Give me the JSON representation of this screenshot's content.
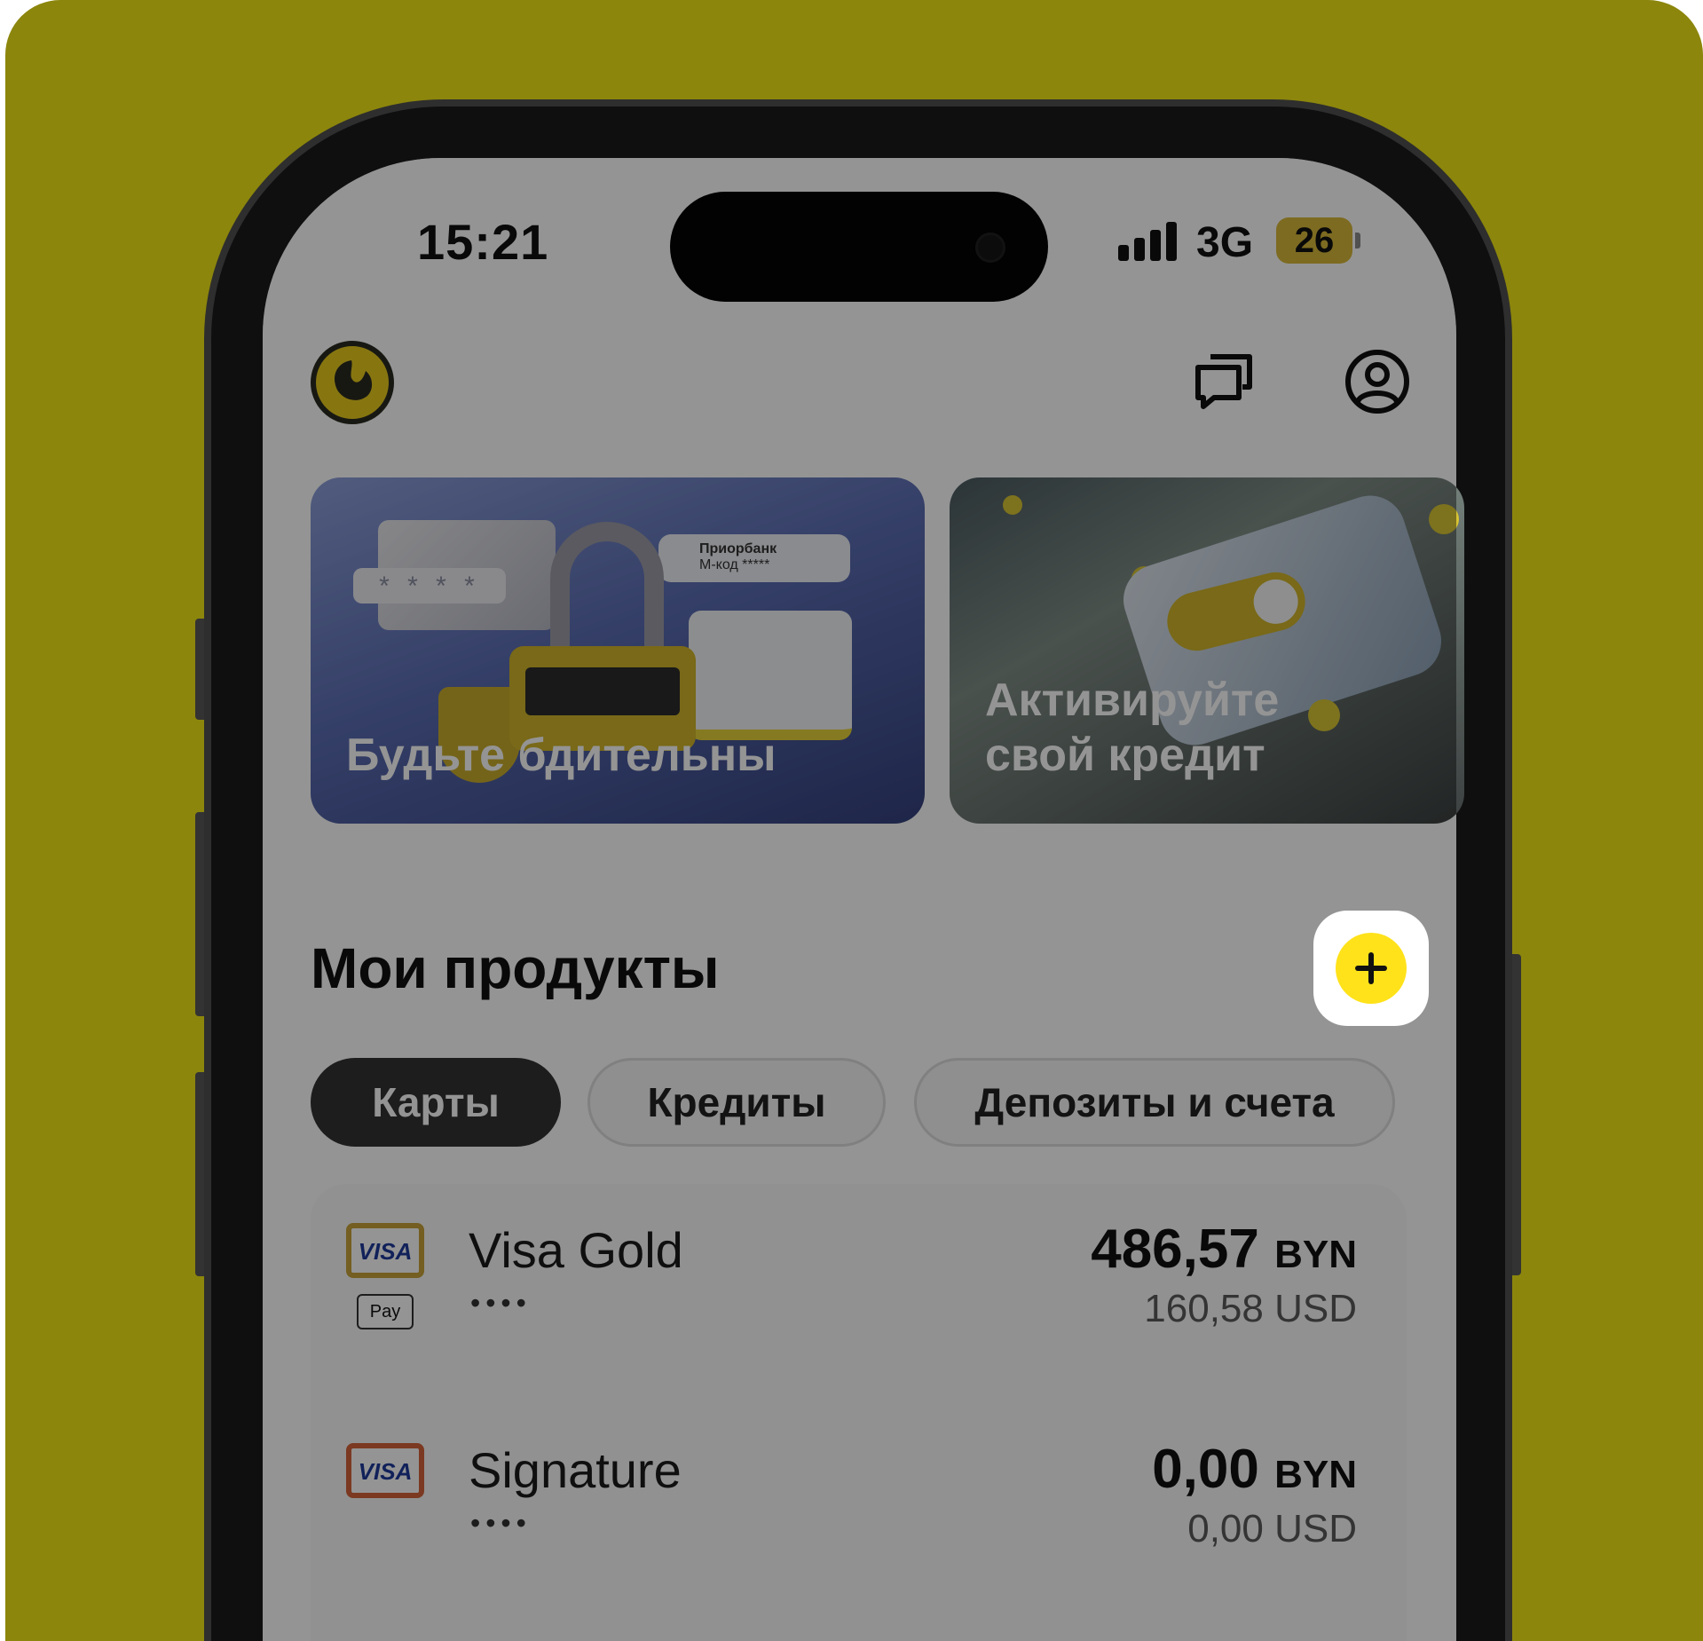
{
  "status_bar": {
    "time": "15:21",
    "network": "3G",
    "battery": "26"
  },
  "header": {
    "logo_icon": "bank-logo-icon",
    "chat_icon": "chat-icon",
    "profile_icon": "profile-icon"
  },
  "banners": [
    {
      "title_line1": "Будьте бдительны",
      "title_line2": "",
      "pin_text": "* * * *",
      "mcode_line1": "Приорбанк",
      "mcode_line2": "М-код *****"
    },
    {
      "title_line1": "Активируйте",
      "title_line2": "свой кредит"
    }
  ],
  "products": {
    "title": "Мои продукты",
    "add_icon": "plus-icon",
    "tabs": [
      "Карты",
      "Кредиты",
      "Депозиты и счета"
    ],
    "cards": [
      {
        "brand": "VISA",
        "wallet": "Pay",
        "name": "Visa Gold",
        "mask": "••••",
        "amount": "486,57",
        "currency": "BYN",
        "amount_usd": "160,58 USD"
      },
      {
        "brand": "VISA",
        "name": "Signature",
        "mask": "••••",
        "amount": "0,00",
        "currency": "BYN",
        "amount_usd": "0,00 USD"
      }
    ]
  },
  "colors": {
    "background": "#8c860c",
    "accent": "#ffe21a",
    "tab_active": "#333333"
  }
}
